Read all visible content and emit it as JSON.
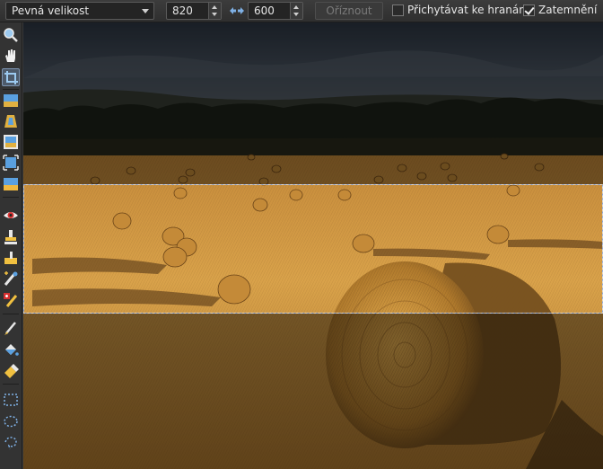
{
  "toolbar": {
    "size_mode": "Pevná velikost",
    "width_value": "820",
    "height_value": "600",
    "crop_label": "Oříznout",
    "snap_label": "Přichytávat ke hranám",
    "snap_checked": false,
    "darken_label": "Zatemnění",
    "darken_checked": true
  },
  "tools": [
    {
      "name": "zoom-icon",
      "active": false
    },
    {
      "name": "hand-icon",
      "active": false
    },
    {
      "name": "crop-icon",
      "active": true
    },
    {
      "name": "straighten-icon",
      "active": false
    },
    {
      "name": "perspective-icon",
      "active": false
    },
    {
      "name": "resize-icon",
      "active": false
    },
    {
      "name": "transform-icon",
      "active": false
    },
    {
      "name": "gradient-icon",
      "active": false
    },
    {
      "name": "red-eye-icon",
      "active": false
    },
    {
      "name": "stamp-icon",
      "active": false
    },
    {
      "name": "smudge-icon",
      "active": false
    },
    {
      "name": "heal-brush-icon",
      "active": false
    },
    {
      "name": "clone-icon",
      "active": false
    },
    {
      "name": "brush-icon",
      "active": false
    },
    {
      "name": "fill-icon",
      "active": false
    },
    {
      "name": "eraser-icon",
      "active": false
    },
    {
      "name": "rect-select-icon",
      "active": false
    },
    {
      "name": "ellipse-select-icon",
      "active": false
    },
    {
      "name": "lasso-select-icon",
      "active": false
    }
  ],
  "colors": {
    "toolbar_bg": "#333333",
    "active_tool": "#4d5a6a",
    "field_gold": "#d29a3c",
    "sky": "#3f4a58",
    "selection_border": "#8fa8d8"
  }
}
